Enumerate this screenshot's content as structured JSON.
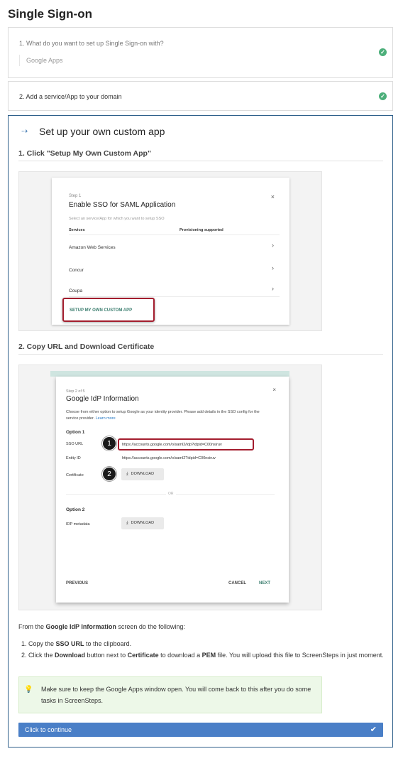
{
  "page": {
    "title": "Single Sign-on"
  },
  "steps": [
    {
      "question": "1. What do you want to set up Single Sign-on with?",
      "answer": "Google Apps"
    },
    {
      "question": "2. Add a service/App to your domain"
    }
  ],
  "main": {
    "title": "Set up your own custom app",
    "section1_heading": "1. Click \"Setup My Own Custom App\"",
    "section2_heading": "2. Copy URL and Download Certificate"
  },
  "dialog1": {
    "step": "Step 1",
    "title": "Enable SSO for SAML Application",
    "description": "Select an service/App for which you want to setup SSO",
    "col_services": "Services",
    "col_provisioning": "Provisioning supported",
    "services": [
      "Amazon Web Services",
      "Concur",
      "Coupa"
    ],
    "custom_app": "SETUP MY OWN CUSTOM APP"
  },
  "dialog2": {
    "step": "Step 2 of 5",
    "title": "Google IdP Information",
    "description": "Choose from either option to setup Google as your identity provider. Please add details in the SSO config for the service provider.",
    "learn_more": "Learn more",
    "option1": "Option 1",
    "sso_url_label": "SSO URL",
    "sso_url": "https://accounts.google.com/o/saml2/idp?idpid=C00nsiruv",
    "entity_id_label": "Entity ID",
    "entity_id": "https://accounts.google.com/o/saml2?idpid=C00nsiruv",
    "certificate_label": "Certificate",
    "download": "DOWNLOAD",
    "or": "OR",
    "option2": "Option 2",
    "idp_metadata_label": "IDP metadata",
    "previous": "PREVIOUS",
    "cancel": "CANCEL",
    "next": "NEXT",
    "badge1": "1",
    "badge2": "2"
  },
  "instructions": {
    "intro_pre": "From the ",
    "intro_bold": "Google IdP Information",
    "intro_post": " screen do the following:",
    "item1_pre": "1. Copy the ",
    "item1_bold": "SSO URL",
    "item1_post": " to the clipboard.",
    "item2_a": "2. Click the ",
    "item2_b": "Download",
    "item2_c": " button next to ",
    "item2_d": "Certificate",
    "item2_e": " to download a ",
    "item2_f": "PEM",
    "item2_g": " file. You will upload this file to ScreenSteps in just moment."
  },
  "tip": {
    "text": "Make sure to keep the Google Apps window open. You will come back to this after you do some tasks in ScreenSteps."
  },
  "continue_button": {
    "label": "Click to continue"
  },
  "colors": {
    "accent": "#4a7fc7",
    "success": "#4caf7a",
    "highlight": "#a31d2e",
    "tip_bg": "#edf8e8"
  }
}
